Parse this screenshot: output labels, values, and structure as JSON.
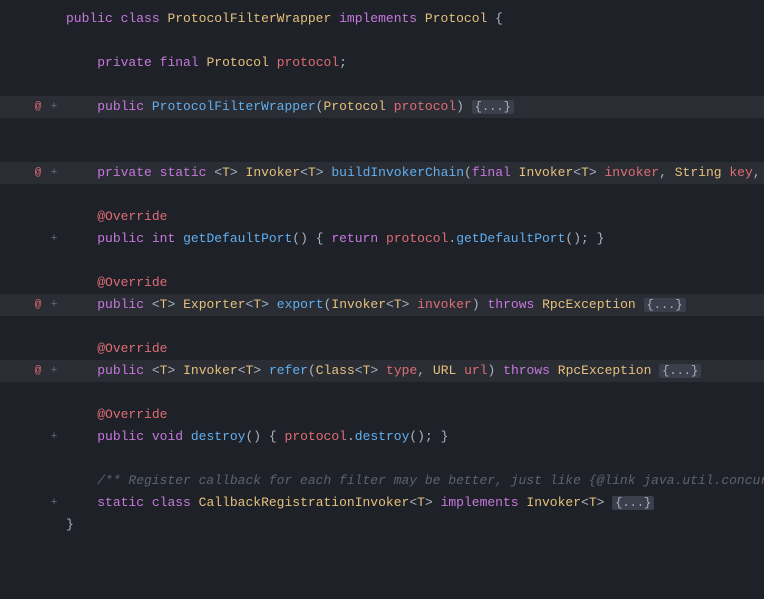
{
  "editor": {
    "background": "#1e2228",
    "lines": [
      {
        "id": 1,
        "indent": 0,
        "hasMarker": false,
        "hasFold": false,
        "content": "public_class_ProtocolFilterWrapper_implements_Protocol"
      }
    ]
  }
}
